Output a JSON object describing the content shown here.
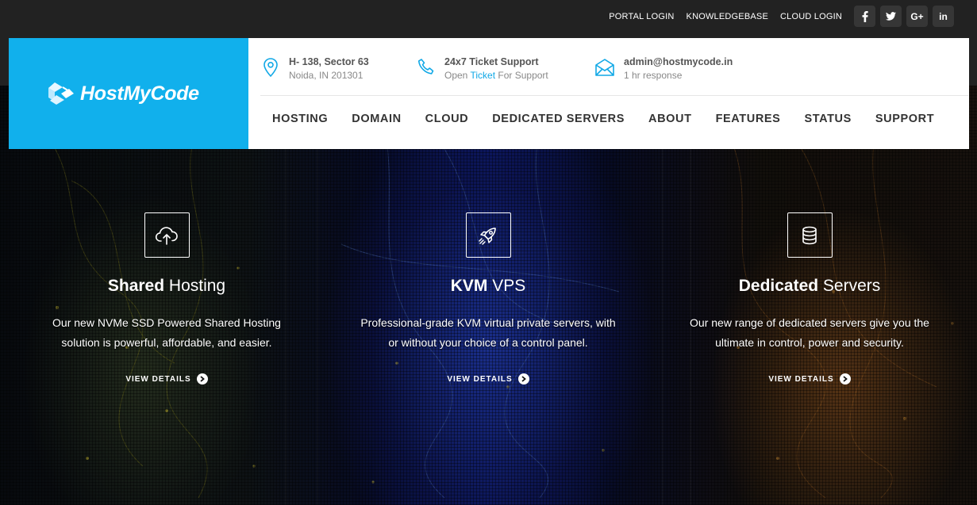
{
  "brand": {
    "name": "HostMyCode",
    "accent": "#11b0ec"
  },
  "topbar": {
    "links": [
      "PORTAL LOGIN",
      "KNOWLEDGEBASE",
      "CLOUD LOGIN"
    ],
    "social": [
      {
        "icon": "facebook-icon",
        "glyph": "f"
      },
      {
        "icon": "twitter-icon",
        "glyph": "t"
      },
      {
        "icon": "google-plus-icon",
        "glyph": "G+"
      },
      {
        "icon": "linkedin-icon",
        "glyph": "in"
      }
    ]
  },
  "contact": {
    "address": {
      "icon": "map-pin-icon",
      "title": "H- 138, Sector 63",
      "sub": "Noida, IN 201301"
    },
    "support": {
      "icon": "phone-icon",
      "title": "24x7 Ticket Support",
      "sub_before": "Open ",
      "sub_link": "Ticket",
      "sub_after": " For Support"
    },
    "email": {
      "icon": "envelope-icon",
      "title": "admin@hostmycode.in",
      "sub": "1 hr response"
    }
  },
  "nav": [
    "HOSTING",
    "DOMAIN",
    "CLOUD",
    "DEDICATED SERVERS",
    "ABOUT",
    "FEATURES",
    "STATUS",
    "SUPPORT"
  ],
  "features": [
    {
      "icon": "cloud-upload-icon",
      "title_bold": "Shared",
      "title_rest": " Hosting",
      "desc": "Our new NVMe SSD Powered Shared Hosting solution is powerful, affordable, and easier.",
      "cta": "VIEW DETAILS"
    },
    {
      "icon": "rocket-icon",
      "title_bold": "KVM",
      "title_rest": " VPS",
      "desc": "Professional-grade KVM virtual private servers, with or without your choice of a control panel.",
      "cta": "VIEW DETAILS"
    },
    {
      "icon": "database-icon",
      "title_bold": "Dedicated",
      "title_rest": " Servers",
      "desc": "Our new range of dedicated servers give you the ultimate in control, power and security.",
      "cta": "VIEW DETAILS"
    }
  ]
}
